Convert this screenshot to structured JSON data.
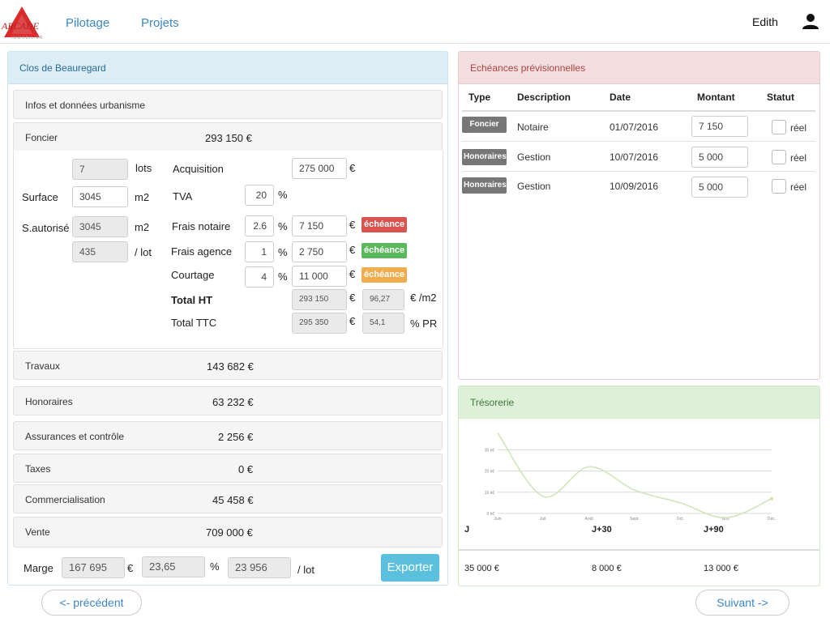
{
  "header": {
    "logo_text": "ARCADE",
    "logo_subtext": "IMMOBILIER",
    "nav": [
      "Pilotage",
      "Projets"
    ],
    "user_name": "Edith"
  },
  "left_panel": {
    "title": "Clos de Beauregard",
    "infos_label": "Infos et données urbanisme",
    "foncier": {
      "label": "Foncier",
      "amount": "293 150 €",
      "lots_value": "7",
      "lots_unit": "lots",
      "surface_label": "Surface",
      "surface_value": "3045",
      "surface_unit": "m2",
      "sautorise_label": "S.autorisé",
      "sautorise_value": "3045",
      "sautorise_unit": "m2",
      "per_lot_value": "435",
      "per_lot_unit": "/ lot",
      "acquisition_label": "Acquisition",
      "acquisition_value": "275 000",
      "tva_label": "TVA",
      "tva_value": "20",
      "frais_notaire_label": "Frais notaire",
      "frais_notaire_pct": "2.6",
      "frais_notaire_value": "7 150",
      "frais_agence_label": "Frais agence",
      "frais_agence_pct": "1",
      "frais_agence_value": "2 750",
      "courtage_label": "Courtage",
      "courtage_pct": "4",
      "courtage_value": "11 000",
      "total_ht_label": "Total HT",
      "total_ht_value": "293 150",
      "total_ht_per_m2": "96,27",
      "per_m2_unit": "€ /m2",
      "total_ttc_label": "Total TTC",
      "total_ttc_value": "295 350",
      "total_ttc_pct": "54,1",
      "pct_pr_unit": "% PR",
      "echeance_label": "échéance",
      "euro": "€",
      "percent": "%"
    },
    "sections": [
      {
        "label": "Travaux",
        "amount": "143 682 €"
      },
      {
        "label": "Honoraires",
        "amount": "63 232 €"
      },
      {
        "label": "Assurances et contrôle",
        "amount": "2 256 €"
      },
      {
        "label": "Taxes",
        "amount": "0 €"
      },
      {
        "label": "Commercialisation",
        "amount": "45 458 €"
      },
      {
        "label": "Vente",
        "amount": "709 000 €"
      }
    ],
    "marge": {
      "label": "Marge",
      "value": "167 695",
      "pct": "23,65",
      "per_lot": "23 956",
      "per_lot_unit": "/ lot"
    },
    "export_label": "Exporter"
  },
  "echeances": {
    "title": "Echéances prévisionnelles",
    "columns": [
      "Type",
      "Description",
      "Date",
      "Montant",
      "Statut"
    ],
    "rows": [
      {
        "type": "Foncier",
        "description": "Notaire",
        "date": "01/07/2016",
        "montant": "7 150",
        "statut": "réel"
      },
      {
        "type": "Honoraires",
        "description": "Gestion",
        "date": "10/07/2016",
        "montant": "5 000",
        "statut": "réel"
      },
      {
        "type": "Honoraires",
        "description": "Gestion",
        "date": "10/09/2016",
        "montant": "5 000",
        "statut": "réel"
      }
    ]
  },
  "tresorerie": {
    "title": "Trésorerie",
    "horizons": [
      "J",
      "J+30",
      "J+90"
    ],
    "values": [
      "35 000 €",
      "8 000 €",
      "13 000 €"
    ]
  },
  "chart_data": {
    "type": "line",
    "categories": [
      "Juin",
      "Juil.",
      "Août",
      "Sept.",
      "Oct.",
      "Nov.",
      "Déc."
    ],
    "series": [
      {
        "values": [
          38000,
          8000,
          22000,
          11000,
          5000,
          -2000,
          7000
        ]
      }
    ],
    "ytick_labels": [
      "0 k€",
      "10 k€",
      "20 k€",
      "30 k€"
    ],
    "ylim": [
      0,
      42000
    ],
    "line_color": "#cfe6b7",
    "grid": true
  },
  "footer": {
    "prev_label": "<- précédent",
    "next_label": "Suivant ->"
  }
}
